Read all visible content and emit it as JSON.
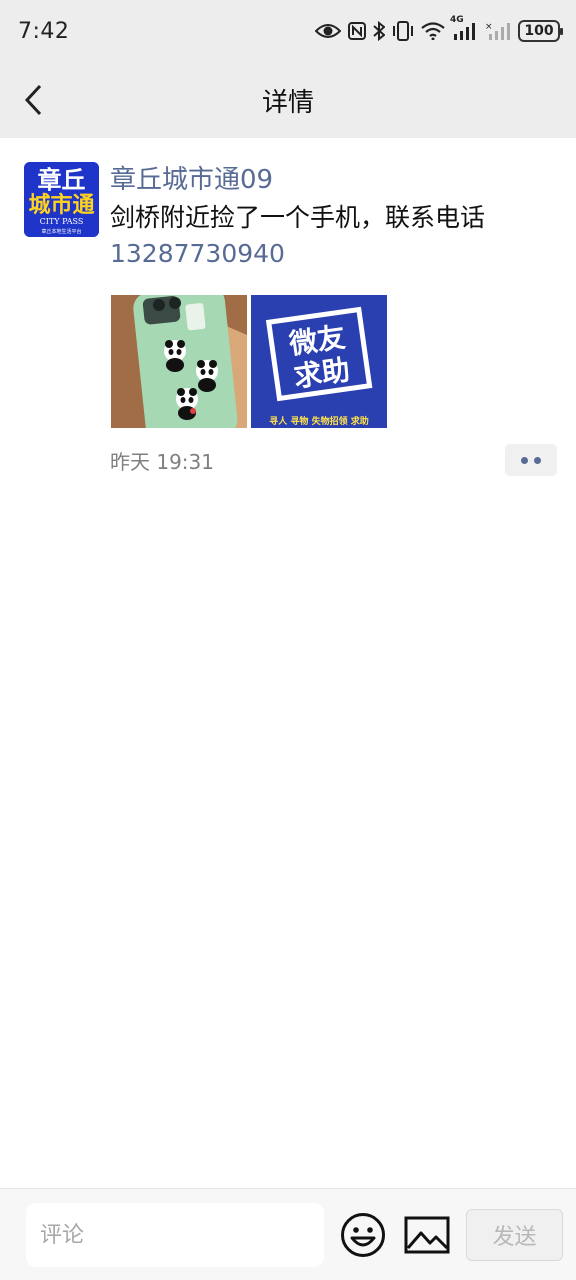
{
  "status_bar": {
    "time": "7:42",
    "network": "4G",
    "battery": "100",
    "icons": [
      "eye-icon",
      "nfc-icon",
      "bluetooth-icon",
      "vibrate-icon",
      "wifi-icon",
      "signal-icon",
      "signal-x-icon",
      "battery-icon"
    ]
  },
  "nav": {
    "title": "详情",
    "back_icon": "chevron-left-icon"
  },
  "post": {
    "author": "章丘城市通09",
    "avatar_text": {
      "line1": "章丘",
      "line2": "城市通",
      "line3": "CITY PASS",
      "line4": "章丘本地生活平台"
    },
    "content": "剑桥附近捡了一个手机，联系电话",
    "phone": "13287730940",
    "images": [
      {
        "name": "phone-case-photo",
        "description_icon": "panda-case-icon"
      },
      {
        "name": "help-poster",
        "text_line1": "微友",
        "text_line2": "求助",
        "caption": "寻人 寻物 失物招领 求助"
      }
    ],
    "timestamp": "昨天 19:31"
  },
  "comment_bar": {
    "placeholder": "评论",
    "send_label": "发送"
  },
  "colors": {
    "link": "#576b95",
    "bar_bg": "#ededed",
    "poster_blue": "#2a3fb0"
  }
}
